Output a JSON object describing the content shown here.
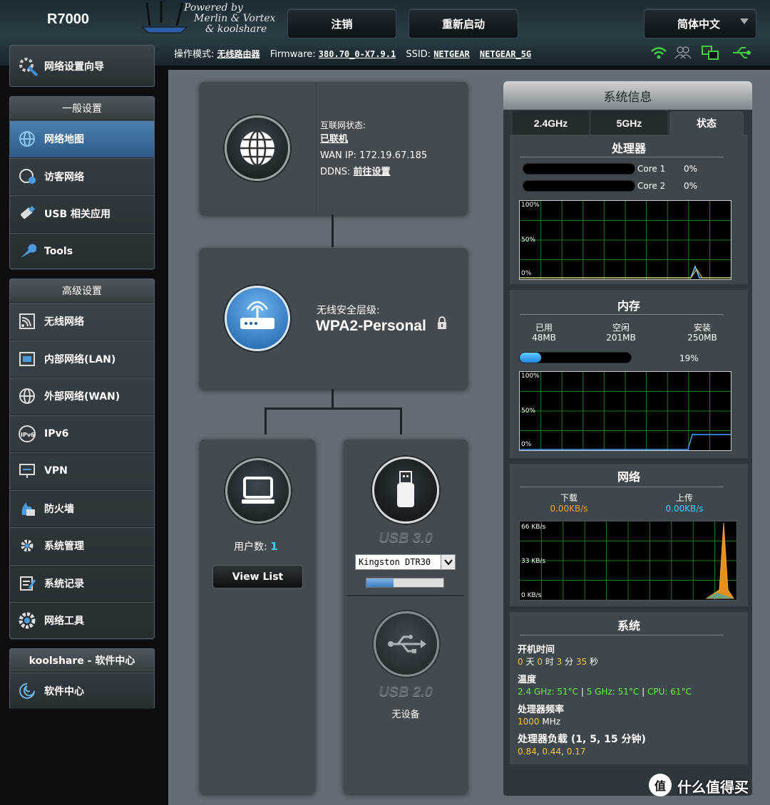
{
  "header": {
    "model": "R7000",
    "powered_line1": "Powered by",
    "powered_line2": "Merlin & Vortex",
    "powered_line3": "& koolshare",
    "logout": "注销",
    "reboot": "重新启动",
    "language": "简体中文"
  },
  "infobar": {
    "mode_label": "操作模式:",
    "mode_value": "无线路由器",
    "firmware_label": "Firmware:",
    "firmware_value": "380.70_0-X7.9.1",
    "ssid_label": "SSID:",
    "ssid_24": "NETGEAR",
    "ssid_5": "NETGEAR_5G"
  },
  "sidebar": {
    "wizard": "网络设置向导",
    "general_head": "一般设置",
    "general": [
      {
        "label": "网络地图",
        "icon": "globe-map-icon"
      },
      {
        "label": "访客网络",
        "icon": "guest-network-icon"
      },
      {
        "label": "USB 相关应用",
        "icon": "usb-icon"
      },
      {
        "label": "Tools",
        "icon": "wrench-icon"
      }
    ],
    "advanced_head": "高级设置",
    "advanced": [
      {
        "label": "无线网络",
        "icon": "wireless-icon"
      },
      {
        "label": "内部网络(LAN)",
        "icon": "lan-icon"
      },
      {
        "label": "外部网络(WAN)",
        "icon": "wan-globe-icon"
      },
      {
        "label": "IPv6",
        "icon": "ipv6-icon"
      },
      {
        "label": "VPN",
        "icon": "vpn-icon"
      },
      {
        "label": "防火墙",
        "icon": "firewall-icon"
      },
      {
        "label": "系统管理",
        "icon": "admin-gear-icon"
      },
      {
        "label": "系统记录",
        "icon": "log-icon"
      },
      {
        "label": "网络工具",
        "icon": "network-tools-icon"
      }
    ],
    "software_head": "koolshare - 软件中心",
    "software": "软件中心"
  },
  "map": {
    "internet_status_label": "互联网状态:",
    "internet_status": "已联机",
    "wan_ip_label": "WAN IP:",
    "wan_ip": "172.19.67.185",
    "ddns_label": "DDNS:",
    "ddns_value": "前往设置",
    "security_label": "无线安全层级:",
    "security_value": "WPA2-Personal",
    "clients_label": "用户数:",
    "clients_count": "1",
    "view_list": "View List",
    "usb3_label": "USB 3.0",
    "usb3_device": "Kingston DTR30",
    "usb3_progress": 0.35,
    "usb2_label": "USB 2.0",
    "usb2_status": "无设备"
  },
  "system": {
    "title": "系统信息",
    "tabs": [
      "2.4GHz",
      "5GHz",
      "状态"
    ],
    "cpu": {
      "title": "处理器",
      "cores": [
        {
          "name": "Core 1",
          "value": "0%"
        },
        {
          "name": "Core 2",
          "value": "0%"
        }
      ],
      "y_labels": [
        "100%",
        "50%",
        "0%"
      ]
    },
    "memory": {
      "title": "内存",
      "used_label": "已用",
      "used": "48MB",
      "free_label": "空闲",
      "free": "201MB",
      "total_label": "安装",
      "total": "250MB",
      "percent": "19%",
      "fraction": 0.19,
      "y_labels": [
        "100%",
        "50%",
        "0%"
      ]
    },
    "network": {
      "title": "网络",
      "down_label": "下载",
      "down_value": "0.00KB/s",
      "up_label": "上传",
      "up_value": "0.00KB/s",
      "y_labels": [
        "66 KB/s",
        "33 KB/s",
        "0 KB/s"
      ]
    },
    "sysinfo": {
      "title": "系统",
      "uptime_label": "开机时间",
      "uptime": {
        "d": "0",
        "d_unit": "天",
        "h": "0",
        "h_unit": "时",
        "m": "3",
        "m_unit": "分",
        "s": "35",
        "s_unit": "秒"
      },
      "temp_label": "温度",
      "temp_24": "2.4 GHz: 51°C",
      "temp_5": "5 GHz: 51°C",
      "temp_cpu": "CPU: 61°C",
      "sep": "|",
      "freq_label": "处理器频率",
      "freq_value": "1000",
      "freq_unit": "MHz",
      "load_label": "处理器负载 (1, 5, 15 分钟)",
      "load_1": "0.84",
      "load_5": "0.44",
      "load_15": "0.17",
      "comma": ","
    }
  },
  "watermark": {
    "text": "什么值得买",
    "badge": "值"
  },
  "colors": {
    "active_blue": "#3a6e9e",
    "value_yellow": "#f6c443",
    "value_green": "#66f046",
    "value_cyan": "#44c9ff"
  }
}
